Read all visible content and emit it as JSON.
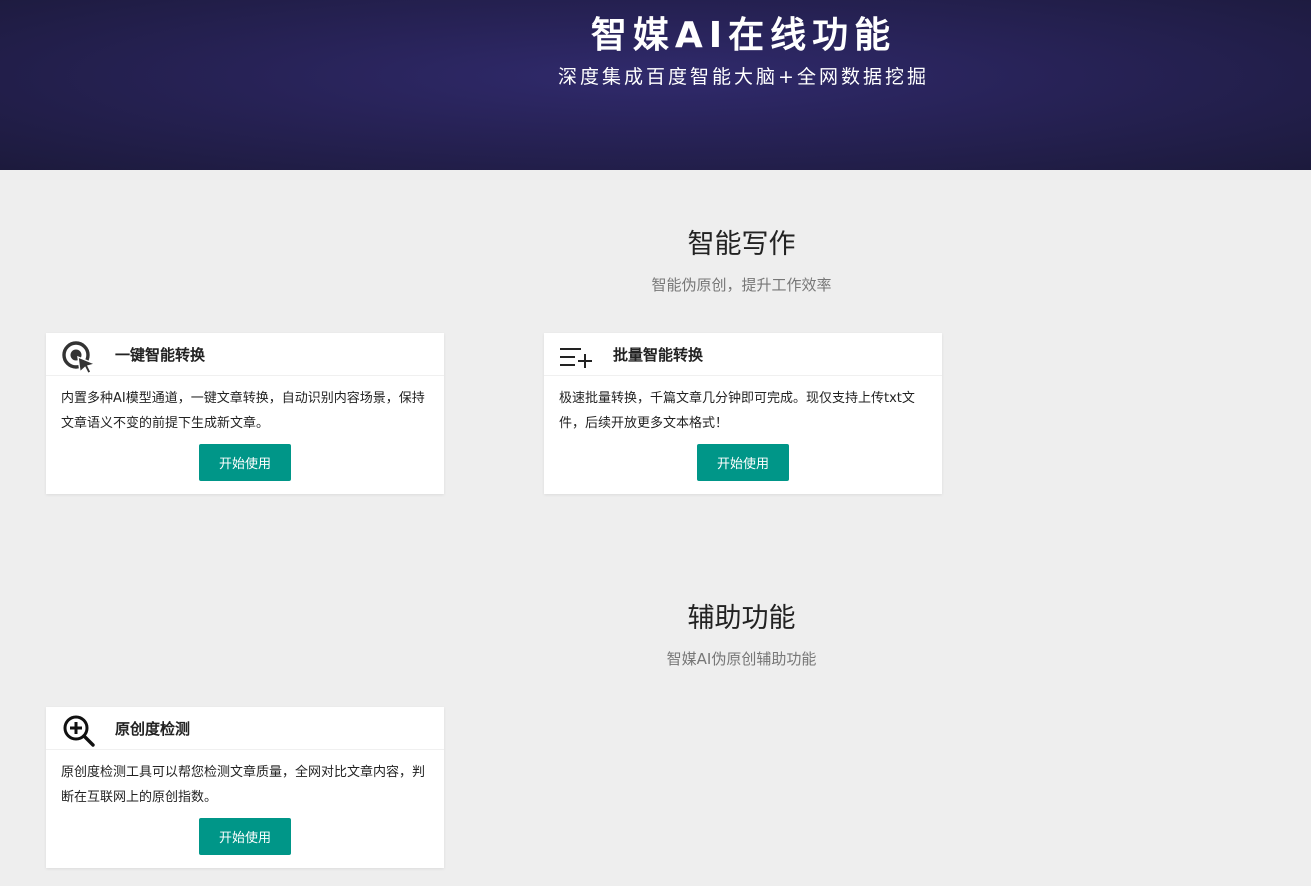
{
  "hero": {
    "title": "智媒AI在线功能",
    "subtitle": "深度集成百度智能大脑+全网数据挖掘"
  },
  "sections": [
    {
      "title": "智能写作",
      "subtitle": "智能伪原创，提升工作效率",
      "cards": [
        {
          "icon": "pointer-target-icon",
          "title": "一键智能转换",
          "desc": "内置多种AI模型通道，一键文章转换，自动识别内容场景，保持文章语义不变的前提下生成新文章。",
          "button": "开始使用"
        },
        {
          "icon": "list-add-icon",
          "title": "批量智能转换",
          "desc": "极速批量转换，千篇文章几分钟即可完成。现仅支持上传txt文件，后续开放更多文本格式！",
          "button": "开始使用"
        }
      ]
    },
    {
      "title": "辅助功能",
      "subtitle": "智媒AI伪原创辅助功能",
      "cards": [
        {
          "icon": "zoom-in-icon",
          "title": "原创度检测",
          "desc": "原创度检测工具可以帮您检测文章质量，全网对比文章内容，判断在互联网上的原创指数。",
          "button": "开始使用"
        }
      ]
    }
  ]
}
